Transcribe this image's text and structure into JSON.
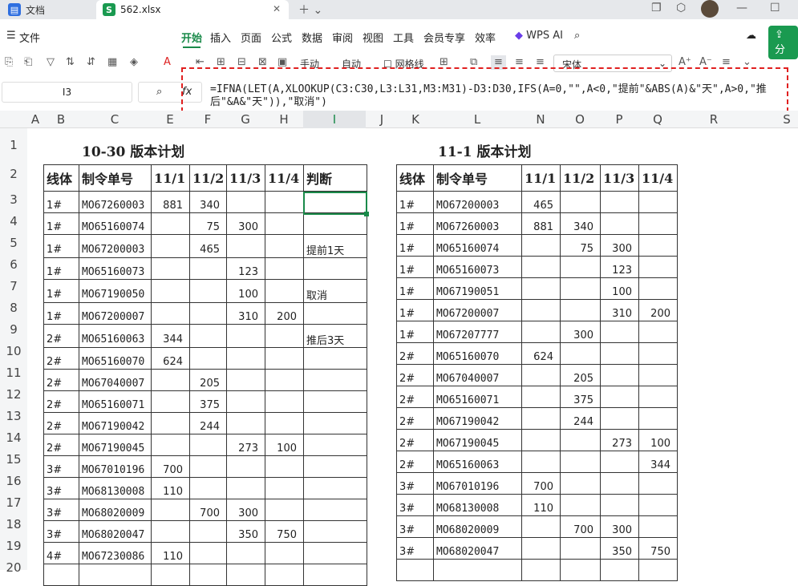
{
  "tabs": {
    "docs_label": "文档",
    "file_label": "562.xlsx",
    "file_badge": "S"
  },
  "menu": {
    "file": "文件",
    "items": [
      "开始",
      "插入",
      "页面",
      "公式",
      "数据",
      "审阅",
      "视图",
      "工具",
      "会员专享",
      "效率"
    ],
    "wps_ai": "WPS AI",
    "share": "分"
  },
  "ribbon": {
    "fill_mode": "手动",
    "auto": "自动",
    "gridlines": "网格线",
    "font": "宋体"
  },
  "namebox": "I3",
  "fx_label": "fx",
  "formula": "=IFNA(LET(A,XLOOKUP(C3:C30,L3:L31,M3:M31)-D3:D30,IFS(A=0,\"\",A<0,\"提前\"&ABS(A)&\"天\",A>0,\"推后\"&A&\"天\")),\"取消\")",
  "columns": [
    "A",
    "B",
    "C",
    "D",
    "E",
    "F",
    "G",
    "H",
    "I",
    "J",
    "K",
    "L",
    "M",
    "N",
    "O",
    "P",
    "Q",
    "R",
    "S"
  ],
  "rows": [
    "1",
    "2",
    "3",
    "4",
    "5",
    "6",
    "7",
    "8",
    "9",
    "10",
    "11",
    "12",
    "13",
    "14",
    "15",
    "16",
    "17",
    "18",
    "19",
    "20"
  ],
  "left": {
    "title": "10-30 版本计划",
    "headers": [
      "线体",
      "制令单号",
      "11/1",
      "11/2",
      "11/3",
      "11/4",
      "判断"
    ],
    "rows": [
      [
        "1#",
        "MO67260003",
        "881",
        "340",
        "",
        "",
        ""
      ],
      [
        "1#",
        "MO65160074",
        "",
        "75",
        "300",
        "",
        ""
      ],
      [
        "1#",
        "MO67200003",
        "",
        "465",
        "",
        "",
        "提前1天"
      ],
      [
        "1#",
        "MO65160073",
        "",
        "",
        "123",
        "",
        ""
      ],
      [
        "1#",
        "MO67190050",
        "",
        "",
        "100",
        "",
        "取消"
      ],
      [
        "1#",
        "MO67200007",
        "",
        "",
        "310",
        "200",
        ""
      ],
      [
        "2#",
        "MO65160063",
        "344",
        "",
        "",
        "",
        "推后3天"
      ],
      [
        "2#",
        "MO65160070",
        "624",
        "",
        "",
        "",
        ""
      ],
      [
        "2#",
        "MO67040007",
        "",
        "205",
        "",
        "",
        ""
      ],
      [
        "2#",
        "MO65160071",
        "",
        "375",
        "",
        "",
        ""
      ],
      [
        "2#",
        "MO67190042",
        "",
        "244",
        "",
        "",
        ""
      ],
      [
        "2#",
        "MO67190045",
        "",
        "",
        "273",
        "100",
        ""
      ],
      [
        "3#",
        "MO67010196",
        "700",
        "",
        "",
        "",
        ""
      ],
      [
        "3#",
        "MO68130008",
        "110",
        "",
        "",
        "",
        ""
      ],
      [
        "3#",
        "MO68020009",
        "",
        "700",
        "300",
        "",
        ""
      ],
      [
        "3#",
        "MO68020047",
        "",
        "",
        "350",
        "750",
        ""
      ],
      [
        "4#",
        "MO67230086",
        "110",
        "",
        "",
        "",
        ""
      ],
      [
        "",
        "",
        "",
        "",
        "",
        "",
        ""
      ]
    ]
  },
  "right": {
    "title": "11-1 版本计划",
    "headers": [
      "线体",
      "制令单号",
      "11/1",
      "11/2",
      "11/3",
      "11/4"
    ],
    "rows": [
      [
        "1#",
        "MO67200003",
        "465",
        "",
        "",
        ""
      ],
      [
        "1#",
        "MO67260003",
        "881",
        "340",
        "",
        ""
      ],
      [
        "1#",
        "MO65160074",
        "",
        "75",
        "300",
        ""
      ],
      [
        "1#",
        "MO65160073",
        "",
        "",
        "123",
        ""
      ],
      [
        "1#",
        "MO67190051",
        "",
        "",
        "100",
        ""
      ],
      [
        "1#",
        "MO67200007",
        "",
        "",
        "310",
        "200"
      ],
      [
        "1#",
        "MO67207777",
        "",
        "300",
        "",
        ""
      ],
      [
        "2#",
        "MO65160070",
        "624",
        "",
        "",
        ""
      ],
      [
        "2#",
        "MO67040007",
        "",
        "205",
        "",
        ""
      ],
      [
        "2#",
        "MO65160071",
        "",
        "375",
        "",
        ""
      ],
      [
        "2#",
        "MO67190042",
        "",
        "244",
        "",
        ""
      ],
      [
        "2#",
        "MO67190045",
        "",
        "",
        "273",
        "100"
      ],
      [
        "2#",
        "MO65160063",
        "",
        "",
        "",
        "344"
      ],
      [
        "3#",
        "MO67010196",
        "700",
        "",
        "",
        ""
      ],
      [
        "3#",
        "MO68130008",
        "110",
        "",
        "",
        ""
      ],
      [
        "3#",
        "MO68020009",
        "",
        "700",
        "300",
        ""
      ],
      [
        "3#",
        "MO68020047",
        "",
        "",
        "350",
        "750"
      ],
      [
        "",
        "",
        "",
        "",
        "",
        ""
      ]
    ]
  }
}
